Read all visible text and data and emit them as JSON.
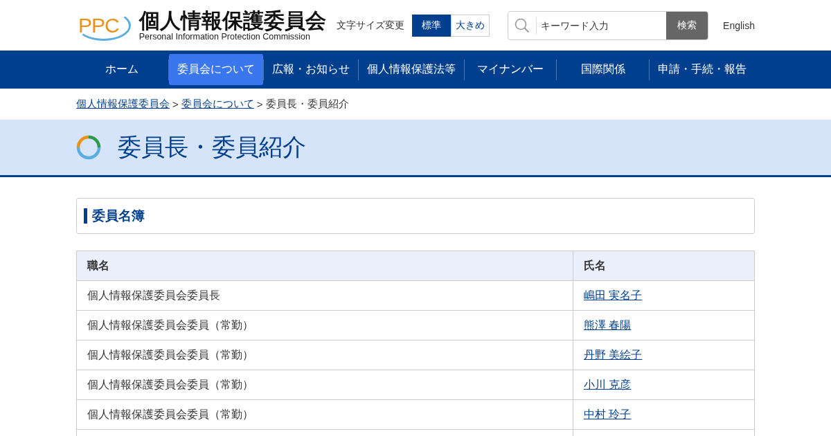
{
  "header": {
    "logo": {
      "mark": "PPC",
      "name": "個人情報保護委員会",
      "subtitle": "Personal Information Protection Commission"
    },
    "font_size": {
      "label": "文字サイズ変更",
      "options": [
        {
          "label": "標準",
          "selected": true
        },
        {
          "label": "大きめ",
          "selected": false
        }
      ]
    },
    "search": {
      "placeholder": "キーワード入力",
      "button": "検索"
    },
    "language_link": "English"
  },
  "nav": [
    {
      "label": "ホーム",
      "selected": false
    },
    {
      "label": "委員会について",
      "selected": true
    },
    {
      "label": "広報・お知らせ",
      "selected": false
    },
    {
      "label": "個人情報保護法等",
      "selected": false
    },
    {
      "label": "マイナンバー",
      "selected": false
    },
    {
      "label": "国際関係",
      "selected": false
    },
    {
      "label": "申請・手続・報告",
      "selected": false
    }
  ],
  "breadcrumb": [
    {
      "kind": "link",
      "label": "個人情報保護委員会"
    },
    {
      "kind": "separator",
      "label": ">"
    },
    {
      "kind": "link",
      "label": "委員会について"
    },
    {
      "kind": "separator",
      "label": ">"
    },
    {
      "kind": "current",
      "label": "委員長・委員紹介"
    }
  ],
  "page_title": "委員長・委員紹介",
  "section_heading": "委員名簿",
  "table": {
    "columns": [
      "職名",
      "氏名"
    ],
    "rows": [
      {
        "title": "個人情報保護委員会委員長",
        "name": "嶋田 実名子"
      },
      {
        "title": "個人情報保護委員会委員（常勤）",
        "name": "熊澤 春陽"
      },
      {
        "title": "個人情報保護委員会委員（常勤）",
        "name": "丹野 美絵子"
      },
      {
        "title": "個人情報保護委員会委員（常勤）",
        "name": "小川 克彦"
      },
      {
        "title": "個人情報保護委員会委員（常勤）",
        "name": "中村 玲子"
      }
    ]
  }
}
